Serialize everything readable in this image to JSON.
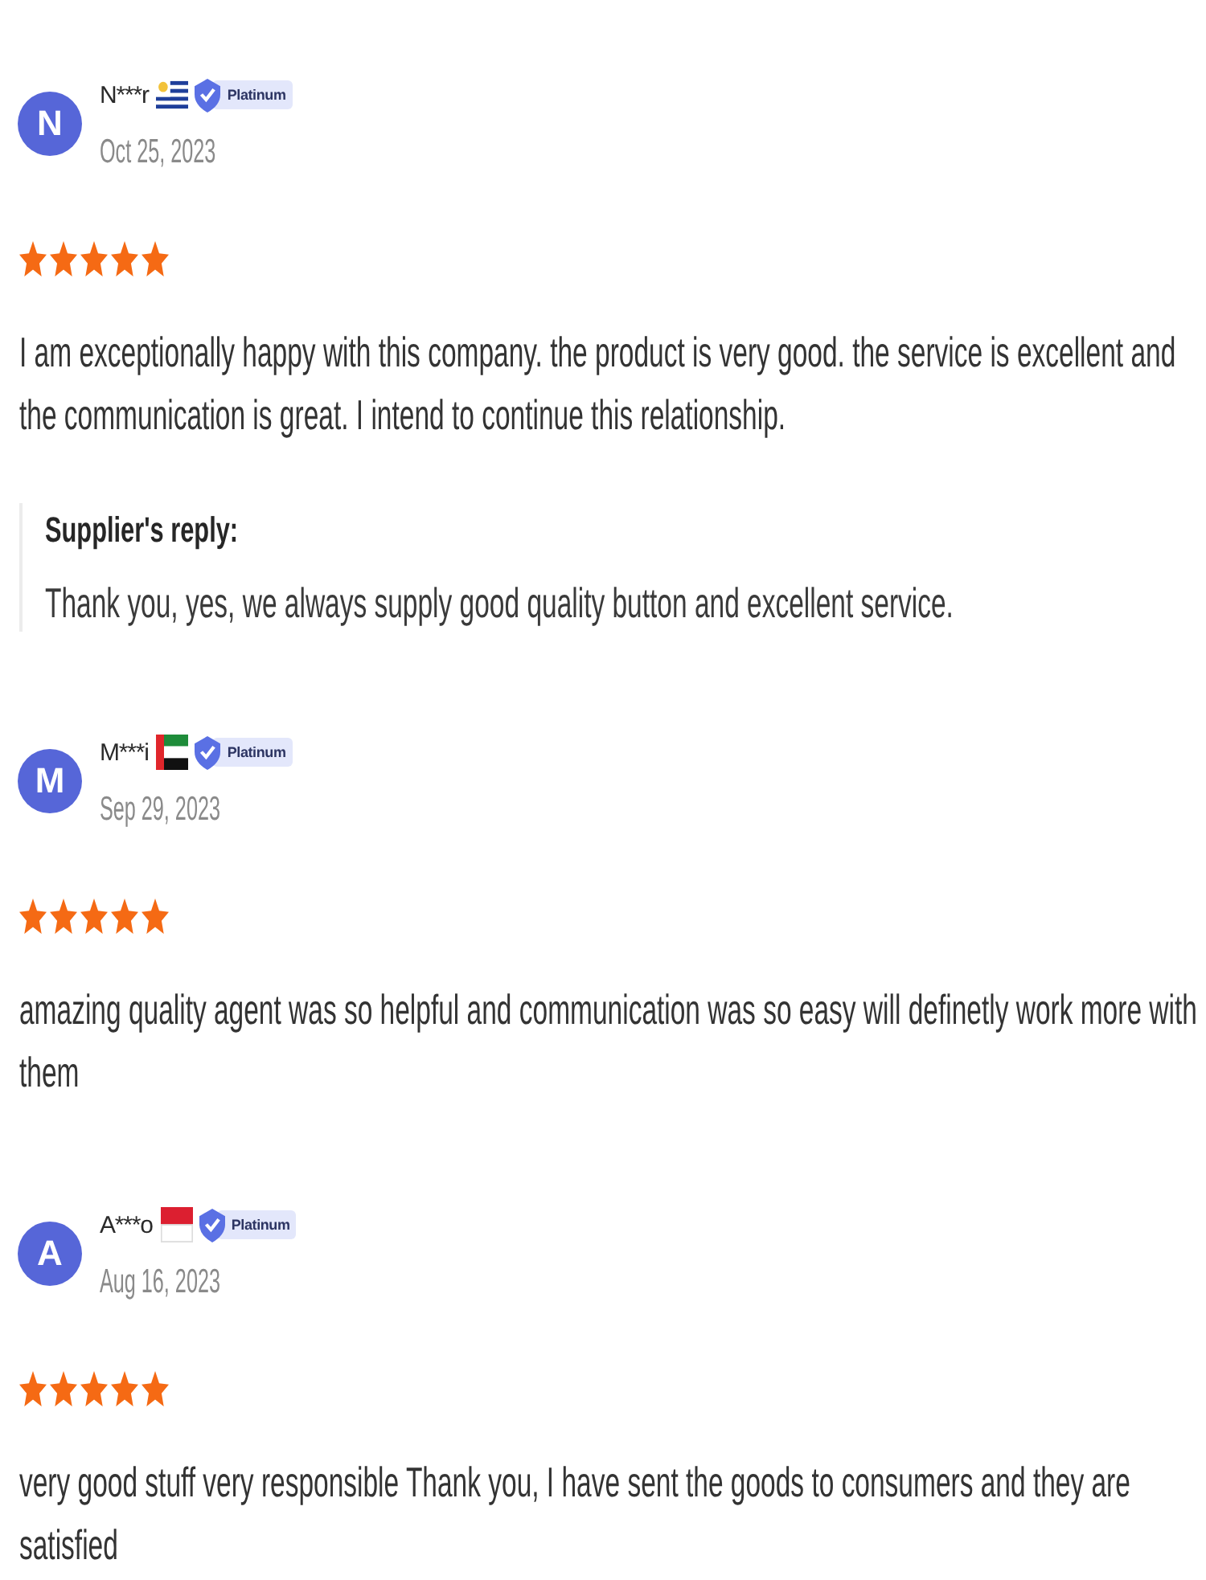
{
  "reviews": [
    {
      "avatar": {
        "initial": "N"
      },
      "name": "N***r",
      "flag": {
        "kind": "uruguay"
      },
      "badge": {
        "label": "Platinum"
      },
      "date": "Oct 25, 2023",
      "stars": 5,
      "text": "I am exceptionally happy with this company. the product is very good. the service is excellent and the communication is great. I intend to continue this relationship.",
      "reply": {
        "title": "Supplier's reply:",
        "text": "Thank you, yes, we always supply good quality button and excellent service."
      }
    },
    {
      "avatar": {
        "initial": "M"
      },
      "name": "M***i",
      "flag": {
        "kind": "uae"
      },
      "badge": {
        "label": "Platinum"
      },
      "date": "Sep 29, 2023",
      "stars": 5,
      "text": "amazing quality agent was so helpful and communication was so easy will definetly work more with them"
    },
    {
      "avatar": {
        "initial": "A"
      },
      "name": "A***o",
      "flag": {
        "kind": "indonesia"
      },
      "badge": {
        "label": "Platinum"
      },
      "date": "Aug 16, 2023",
      "stars": 5,
      "text": "very good stuff very responsible Thank you, I have sent the goods to consumers and they are satisfied"
    }
  ]
}
